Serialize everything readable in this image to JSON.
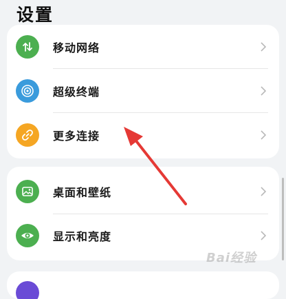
{
  "header": {
    "title": "设置"
  },
  "groups": [
    {
      "items": [
        {
          "label": "移动网络",
          "icon": "mobile-data-icon",
          "color": "#4caf50"
        },
        {
          "label": "超级终端",
          "icon": "super-device-icon",
          "color": "#3a9bdc"
        },
        {
          "label": "更多连接",
          "icon": "link-icon",
          "color": "#f5a623"
        }
      ]
    },
    {
      "items": [
        {
          "label": "桌面和壁纸",
          "icon": "wallpaper-icon",
          "color": "#4caf50"
        },
        {
          "label": "显示和亮度",
          "icon": "eye-icon",
          "color": "#4caf50"
        }
      ]
    }
  ],
  "watermark": {
    "text": "Bai经验"
  },
  "annotation": {
    "color": "#e53935"
  }
}
